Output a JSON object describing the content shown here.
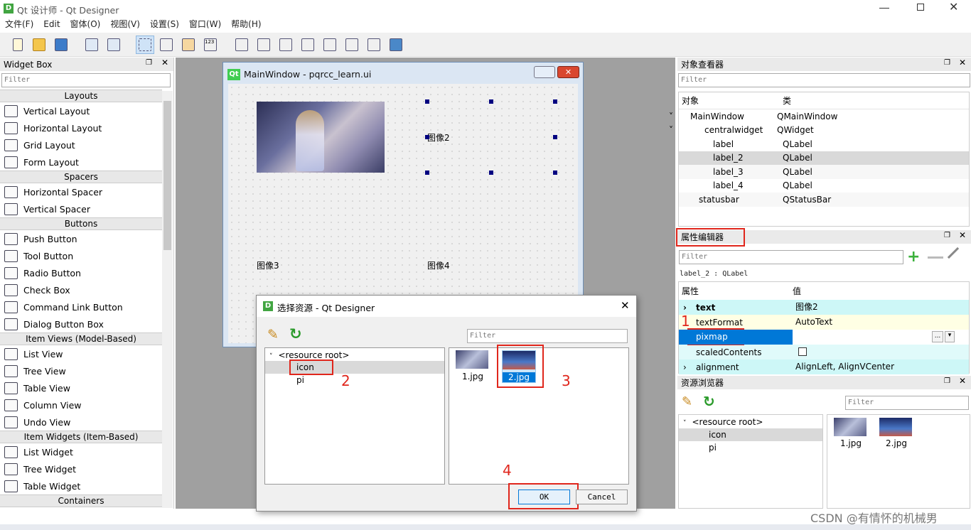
{
  "app": {
    "title": "Qt 设计师 - Qt Designer",
    "logo": "D"
  },
  "menu": [
    "文件(F)",
    "Edit",
    "窗体(O)",
    "视图(V)",
    "设置(S)",
    "窗口(W)",
    "帮助(H)"
  ],
  "widget_box": {
    "title": "Widget Box",
    "filter": "Filter",
    "categories": [
      {
        "name": "Layouts",
        "items": [
          "Vertical Layout",
          "Horizontal Layout",
          "Grid Layout",
          "Form Layout"
        ]
      },
      {
        "name": "Spacers",
        "items": [
          "Horizontal Spacer",
          "Vertical Spacer"
        ]
      },
      {
        "name": "Buttons",
        "items": [
          "Push Button",
          "Tool Button",
          "Radio Button",
          "Check Box",
          "Command Link Button",
          "Dialog Button Box"
        ]
      },
      {
        "name": "Item Views (Model-Based)",
        "items": [
          "List View",
          "Tree View",
          "Table View",
          "Column View",
          "Undo View"
        ]
      },
      {
        "name": "Item Widgets (Item-Based)",
        "items": [
          "List Widget",
          "Tree Widget",
          "Table Widget"
        ]
      },
      {
        "name": "Containers",
        "items": []
      }
    ]
  },
  "main_window": {
    "title": "MainWindow - pqrcc_learn.ui",
    "logo": "Qt",
    "label2": "图像2",
    "label3": "图像3",
    "label4": "图像4"
  },
  "object_inspector": {
    "title": "对象查看器",
    "filter": "Filter",
    "col_object": "对象",
    "col_class": "类",
    "rows": [
      {
        "name": "MainWindow",
        "cls": "QMainWindow"
      },
      {
        "name": "centralwidget",
        "cls": "QWidget"
      },
      {
        "name": "label",
        "cls": "QLabel"
      },
      {
        "name": "label_2",
        "cls": "QLabel"
      },
      {
        "name": "label_3",
        "cls": "QLabel"
      },
      {
        "name": "label_4",
        "cls": "QLabel"
      },
      {
        "name": "statusbar",
        "cls": "QStatusBar"
      }
    ]
  },
  "property_editor": {
    "title": "属性编辑器",
    "filter": "Filter",
    "context": "label_2 : QLabel",
    "col_prop": "属性",
    "col_val": "值",
    "rows": [
      {
        "name": "text",
        "val": "图像2"
      },
      {
        "name": "textFormat",
        "val": "AutoText"
      },
      {
        "name": "pixmap",
        "val": ""
      },
      {
        "name": "scaledContents",
        "val": ""
      },
      {
        "name": "alignment",
        "val": "AlignLeft, AlignVCenter"
      }
    ],
    "ellipsis": "..."
  },
  "resource_browser": {
    "title": "资源浏览器",
    "filter": "Filter",
    "root": "<resource root>",
    "prefixes": [
      "icon",
      "pi"
    ],
    "files": [
      "1.jpg",
      "2.jpg"
    ]
  },
  "dialog": {
    "title": "选择资源 - Qt Designer",
    "filter": "Filter",
    "root": "<resource root>",
    "prefixes": [
      "icon",
      "pi"
    ],
    "files": [
      "1.jpg",
      "2.jpg"
    ],
    "ok": "OK",
    "cancel": "Cancel"
  },
  "annotations": [
    "1",
    "2",
    "3",
    "4"
  ],
  "watermark": "CSDN @有情怀的机械男",
  "colors": {
    "accent": "#0078d7",
    "highlight_red": "#e0261c",
    "selection": "#d9d9d9",
    "property_cyan": "#cdf7f7"
  }
}
